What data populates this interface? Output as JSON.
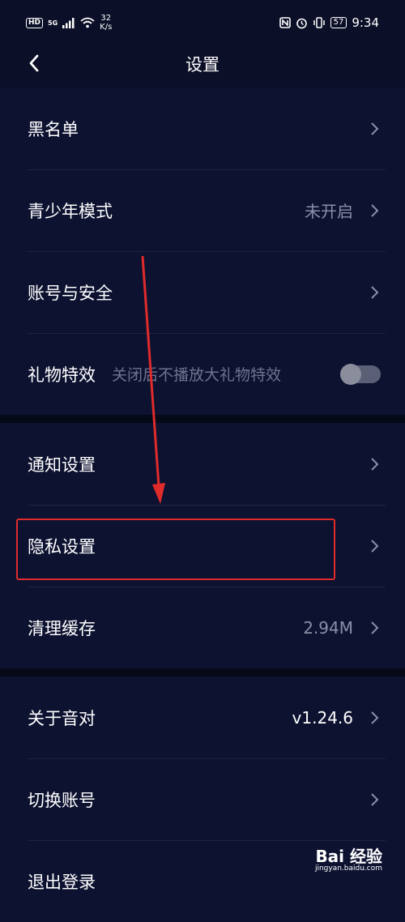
{
  "status_bar": {
    "hd": "HD",
    "network": "5G",
    "speed_value": "32",
    "speed_unit": "K/s",
    "battery": "57",
    "time": "9:34"
  },
  "header": {
    "title": "设置"
  },
  "groups": [
    {
      "rows": [
        {
          "label": "黑名单"
        },
        {
          "label": "青少年模式",
          "value": "未开启"
        },
        {
          "label": "账号与安全"
        },
        {
          "label": "礼物特效",
          "sub": "关闭后不播放大礼物特效",
          "toggle_on": false
        }
      ]
    },
    {
      "rows": [
        {
          "label": "通知设置"
        },
        {
          "label": "隐私设置"
        },
        {
          "label": "清理缓存",
          "value": "2.94M"
        }
      ]
    },
    {
      "rows": [
        {
          "label": "关于音对",
          "value": "v1.24.6"
        },
        {
          "label": "切换账号"
        },
        {
          "label": "退出登录"
        }
      ]
    }
  ],
  "watermark": {
    "main": "Bai  经验",
    "sub": "jingyan.baidu.com"
  },
  "colors": {
    "background": "#0b0f27",
    "highlight": "#e02b2b"
  }
}
